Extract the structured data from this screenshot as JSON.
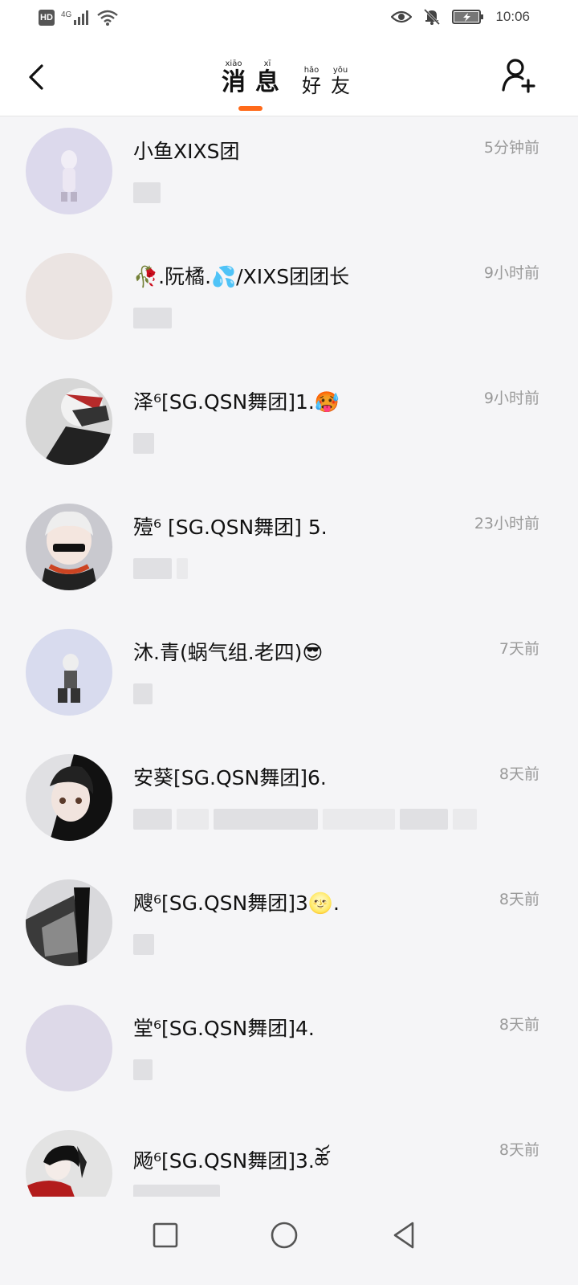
{
  "status_bar": {
    "hd": "HD",
    "network": "4G",
    "time": "10:06",
    "icons": [
      "signal-icon",
      "wifi-icon",
      "eye-icon",
      "bell-off-icon",
      "battery-charging-icon"
    ]
  },
  "header": {
    "tabs": [
      {
        "label": "消息",
        "chars": [
          {
            "c": "消",
            "py": "xiāo"
          },
          {
            "c": "息",
            "py": "xī"
          }
        ],
        "active": true
      },
      {
        "label": "好友",
        "chars": [
          {
            "c": "好",
            "py": "hǎo"
          },
          {
            "c": "友",
            "py": "yǒu"
          }
        ],
        "active": false
      }
    ],
    "accent": "#ff6a1a"
  },
  "messages": [
    {
      "name": "小鱼XIXS团",
      "time": "5分钟前",
      "avatar_color": "#dcd9ec"
    },
    {
      "name": "🥀.阮橘.💦/XIXS团团长",
      "time": "9小时前",
      "avatar_color": "#ebe4e2"
    },
    {
      "name": "泽⁶[SG.QSN舞团]1.🥵",
      "time": "9小时前",
      "avatar_color": "#d7d7d7"
    },
    {
      "name": "殪⁶ [SG.QSN舞团] 5.",
      "time": "23小时前",
      "avatar_color": "#c9c9cf"
    },
    {
      "name": "沐.青(蜗气组.老四)😎",
      "time": "7天前",
      "avatar_color": "#d8dbee"
    },
    {
      "name": "安葵[SG.QSN舞团]6.",
      "time": "8天前",
      "avatar_color": "#e0e0e3"
    },
    {
      "name": "飕⁶[SG.QSN舞团]3🌝.",
      "time": "8天前",
      "avatar_color": "#d9d9dc"
    },
    {
      "name": "堂⁶[SG.QSN舞团]4.",
      "time": "8天前",
      "avatar_color": "#ddd9e8"
    },
    {
      "name": "飏⁶[SG.QSN舞团]3.ཚོ",
      "time": "8天前",
      "avatar_color": "#e3e3e3"
    }
  ],
  "nav_bar": {
    "buttons": [
      "recent-apps-icon",
      "home-icon",
      "back-icon"
    ]
  }
}
